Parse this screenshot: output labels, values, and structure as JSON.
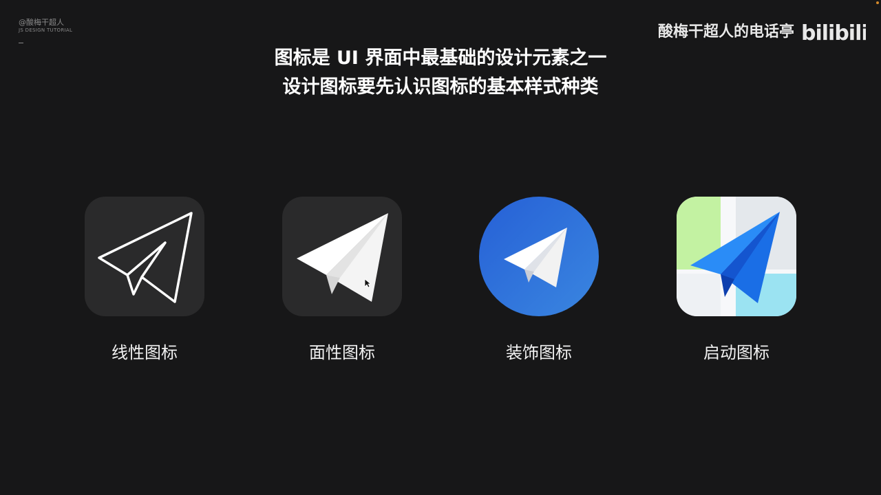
{
  "brand": {
    "name": "@酸梅干超人",
    "subtitle": "JS DESIGN TUTORIAL"
  },
  "watermark": {
    "channel": "酸梅干超人的电话亭",
    "logo": "bilibili",
    "logo_icon": "bilibili-logo-icon"
  },
  "headline": {
    "line1": "图标是 UI 界面中最基础的设计元素之一",
    "line2": "设计图标要先认识图标的基本样式种类"
  },
  "icons": [
    {
      "label": "线性图标",
      "icon": "paper-plane-outline-icon"
    },
    {
      "label": "面性图标",
      "icon": "paper-plane-filled-icon"
    },
    {
      "label": "装饰图标",
      "icon": "paper-plane-decorative-icon"
    },
    {
      "label": "启动图标",
      "icon": "paper-plane-launcher-icon"
    }
  ],
  "colors": {
    "background": "#171718",
    "tile_dark": "#2a2a2b",
    "decorative_blue": "#2f6fdb",
    "launcher_blue": "#1f7cf0",
    "launcher_green": "#c3f2a2",
    "launcher_cyan": "#9be3f2"
  }
}
